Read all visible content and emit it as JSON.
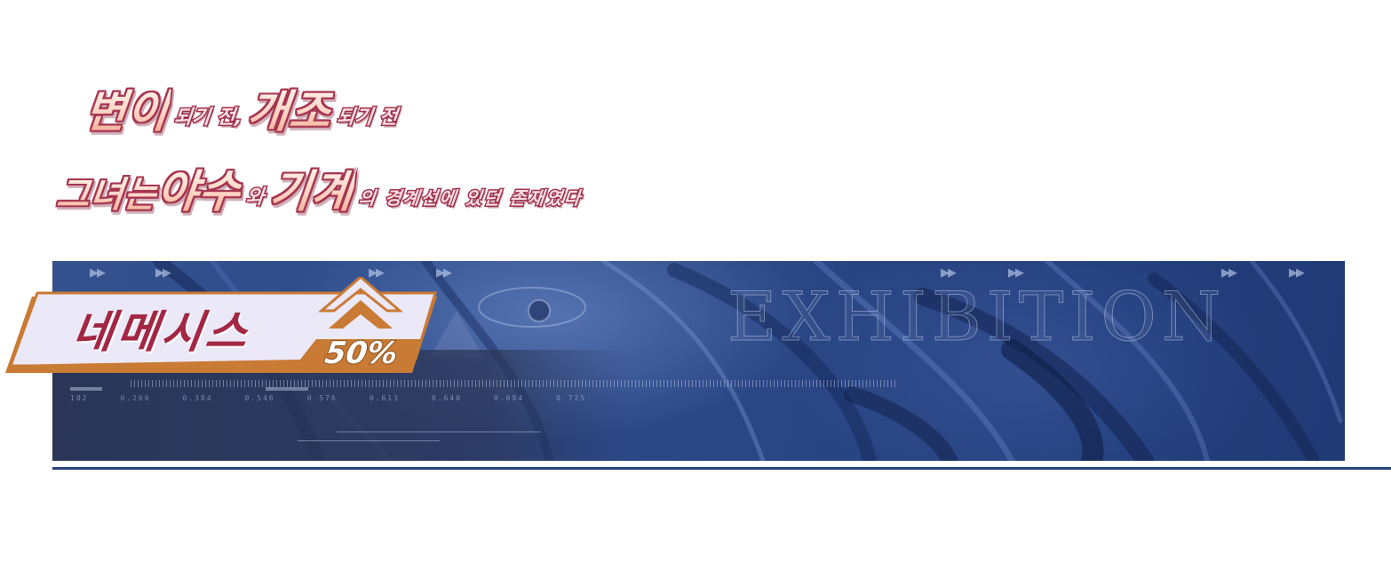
{
  "headline": {
    "line1": {
      "part1": "변이",
      "part2": "되기 전,",
      "part3": "개조",
      "part4": "되기 전"
    },
    "line2": {
      "part1": "그녀는",
      "part2": "야수",
      "part3": "와",
      "part4": "기계",
      "part5": "의 경계선에 있던 존재였다"
    }
  },
  "banner": {
    "watermark": "EXHIBITION",
    "badge": {
      "name": "네메시스",
      "percent": "50%"
    },
    "tick_numbers": [
      "102",
      "0.260",
      "0.384",
      "0.546",
      "0.576",
      "0.613",
      "0.640",
      "0.684",
      "0.725"
    ]
  },
  "colors": {
    "banner_blue": "#2d4a8a",
    "headline_outline": "#a5344f",
    "badge_orange": "#c97a34",
    "badge_fill": "#e9e6f6",
    "underline": "#25427a"
  }
}
